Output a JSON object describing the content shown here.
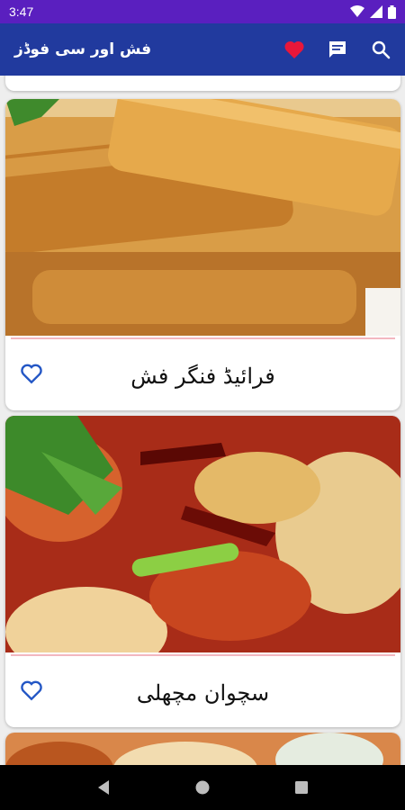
{
  "status_bar": {
    "time": "3:47"
  },
  "app_bar": {
    "title": "فش اور سی فوڈز"
  },
  "colors": {
    "status_bar": "#5a1fbf",
    "app_bar": "#213a9e",
    "favorite": "#e8173a",
    "heart_outline": "#2457c5"
  },
  "recipes": [
    {
      "title": "فرائیڈ فنگر فش",
      "image": "fried-fish-fingers-photo"
    },
    {
      "title": "سچوان مچھلی",
      "image": "szechuan-fish-photo"
    }
  ],
  "icons": {
    "favorites": "heart-icon",
    "chat": "chat-icon",
    "search": "search-icon",
    "back": "back-icon",
    "home": "home-icon",
    "recents": "recents-icon"
  }
}
